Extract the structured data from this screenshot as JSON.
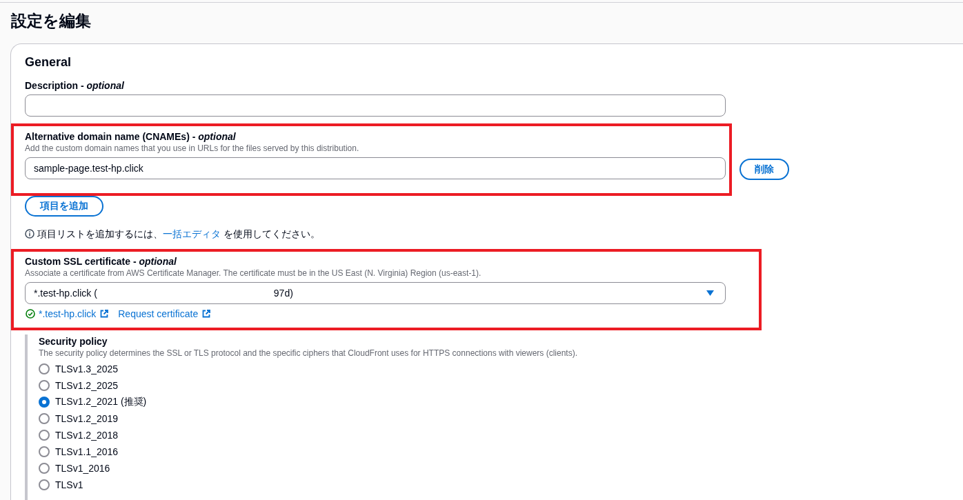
{
  "page": {
    "title": "設定を編集"
  },
  "general": {
    "title": "General",
    "description": {
      "label": "Description - *optional*"
    },
    "cnames": {
      "label": "Alternative domain name (CNAMEs) - *optional*",
      "hint": "Add the custom domain names that you use in URLs for the files served by this distribution.",
      "highlighted": true,
      "items": [
        {
          "value": "sample-page.test-hp.click",
          "remove_button": "削除"
        }
      ],
      "add_button": "項目を追加",
      "info": {
        "text_before": "項目リストを追加するには、",
        "link": "一括エディタ",
        "text_after": " を使用してください。"
      }
    },
    "certificate": {
      "label": "Custom SSL certificate - *optional*",
      "hint": "Associate a certificate from AWS Certificate Manager. The certificate must be in the US East (N. Virginia) Region (us-east-1).",
      "highlighted": true,
      "value_start": "*.test-hp.click (",
      "value_end": "97d)",
      "links": [
        {
          "label": "*.test-hp.click",
          "verified": true
        },
        {
          "label": "Request certificate",
          "verified": false
        }
      ]
    },
    "security_policy": {
      "label": "Security policy",
      "hint": "The security policy determines the SSL or TLS protocol and the specific ciphers that CloudFront uses for HTTPS connections with viewers (clients).",
      "options": [
        {
          "label": "TLSv1.3_2025",
          "selected": false
        },
        {
          "label": "TLSv1.2_2025",
          "selected": false
        },
        {
          "label": "TLSv1.2_2021 (推奨)",
          "selected": true
        },
        {
          "label": "TLSv1.2_2019",
          "selected": false
        },
        {
          "label": "TLSv1.2_2018",
          "selected": false
        },
        {
          "label": "TLSv1.1_2016",
          "selected": false
        },
        {
          "label": "TLSv1_2016",
          "selected": false
        },
        {
          "label": "TLSv1",
          "selected": false
        }
      ]
    }
  }
}
